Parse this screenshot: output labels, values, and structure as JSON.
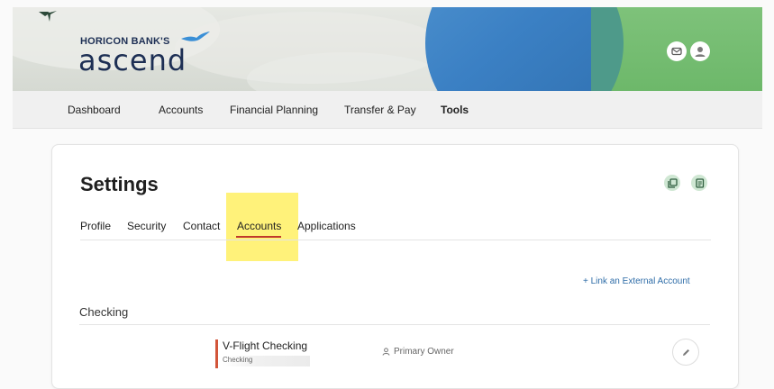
{
  "brand": {
    "small": "HORICON BANK'S",
    "big": "ascend"
  },
  "nav": {
    "items": [
      "Dashboard",
      "Accounts",
      "Financial Planning",
      "Transfer & Pay",
      "Tools"
    ],
    "active": "Tools"
  },
  "settings": {
    "title": "Settings",
    "tabs": [
      "Profile",
      "Security",
      "Contact",
      "Accounts",
      "Applications"
    ],
    "active_tab": "Accounts",
    "link_external": "+  Link an External Account",
    "section": "Checking",
    "account": {
      "name": "V-Flight Checking",
      "type": "Checking",
      "owner": "Primary Owner"
    }
  },
  "colors": {
    "navy": "#1d2f54",
    "accent_red": "#c0392b",
    "link_blue": "#2f6da8",
    "highlight": "#fff27a",
    "icon_green": "#cfe7d3"
  },
  "icons": [
    "mail-icon",
    "user-avatar-icon",
    "copy-icon",
    "document-icon",
    "person-icon",
    "pencil-icon",
    "bird-logo-icon"
  ]
}
